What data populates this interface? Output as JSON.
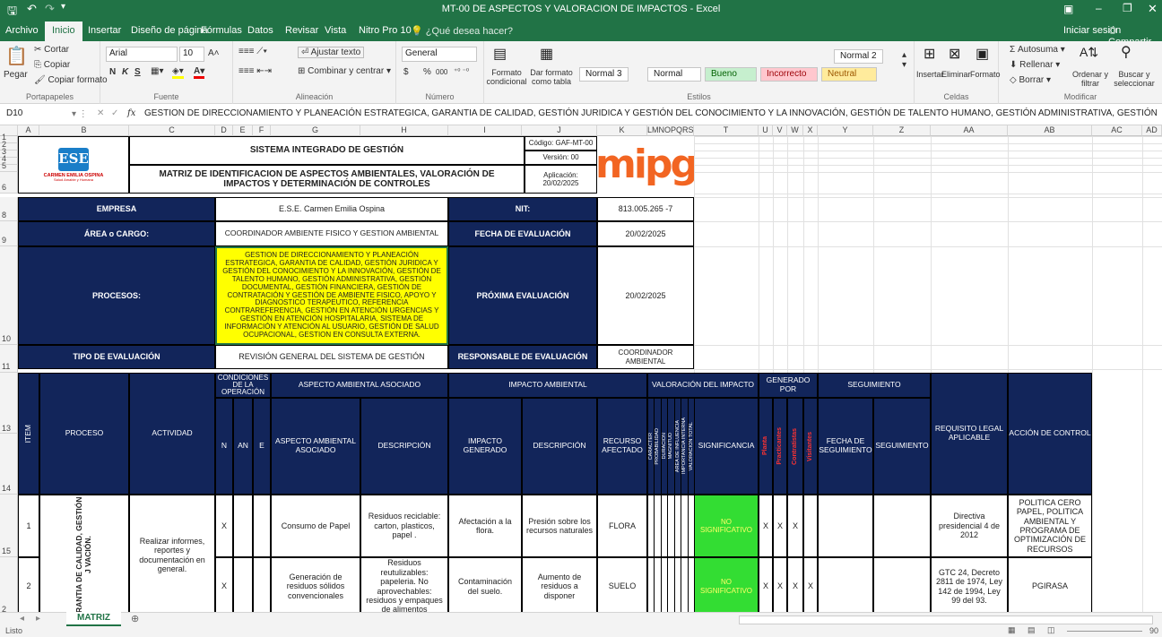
{
  "window": {
    "title": "MT-00 DE ASPECTOS Y VALORACION DE IMPACTOS - Excel",
    "signin": "Iniciar sesión",
    "share": "Compartir"
  },
  "ribbon_tabs": [
    "Archivo",
    "Inicio",
    "Insertar",
    "Diseño de página",
    "Fórmulas",
    "Datos",
    "Revisar",
    "Vista",
    "Nitro Pro 10",
    "¿Qué desea hacer?"
  ],
  "clipboard": {
    "cut": "Cortar",
    "copy": "Copiar",
    "paste": "Pegar",
    "format_painter": "Copiar formato",
    "label": "Portapapeles"
  },
  "font": {
    "name": "Arial",
    "size": "10",
    "bold": "N",
    "italic": "K",
    "underline": "S",
    "label": "Fuente"
  },
  "alignment": {
    "wrap": "Ajustar texto",
    "merge": "Combinar y centrar",
    "label": "Alineación"
  },
  "number": {
    "format": "General",
    "currency": "$",
    "percent": "%",
    "thousands": "000",
    "label": "Número"
  },
  "styles": {
    "conditional": "Formato condicional",
    "as_table": "Dar formato como tabla",
    "normal3": "Normal 3",
    "normal2": "Normal 2",
    "normal": "Normal",
    "good": "Bueno",
    "bad": "Incorrecto",
    "neutral": "Neutral",
    "label": "Estilos"
  },
  "cells_group": {
    "insert": "Insertar",
    "delete": "Eliminar",
    "format": "Formato",
    "label": "Celdas"
  },
  "editing": {
    "autosum": "Autosuma",
    "fill": "Rellenar",
    "clear": "Borrar",
    "sort": "Ordenar y filtrar",
    "find": "Buscar y seleccionar",
    "label": "Modificar"
  },
  "formula_bar": {
    "name_box": "D10",
    "fx": "fx",
    "content": "GESTION DE DIRECCIONAMIENTO Y PLANEACIÓN ESTRATEGICA, GARANTIA DE CALIDAD, GESTIÓN JURIDICA Y GESTIÓN DEL CONOCIMIENTO Y LA INNOVACIÓN, GESTIÓN DE TALENTO HUMANO, GESTIÓN ADMINISTRATIVA, GESTIÓN DOCUMENTAL, GESTIÓN FINANCIERA,"
  },
  "columns": [
    "A",
    "B",
    "C",
    "D",
    "E",
    "F",
    "G",
    "H",
    "I",
    "J",
    "K",
    "LMNOPQRS",
    "T",
    "U",
    "V",
    "W",
    "X",
    "Y",
    "Z",
    "AA",
    "AB",
    "AC",
    "AD"
  ],
  "rows": [
    "1",
    "2",
    "3",
    "4",
    "5",
    "6",
    "8",
    "9",
    "10",
    "11",
    "13",
    "14",
    "15",
    "2"
  ],
  "doc": {
    "logo_text": "ESE",
    "logo_sub": "CARMEN EMILIA OSPINA",
    "logo_tag": "Salud Amable y Humana",
    "system_title": "SISTEMA INTEGRADO DE GESTIÓN",
    "matrix_title": "MATRIZ DE IDENTIFICACION DE ASPECTOS AMBIENTALES, VALORACIÓN DE IMPACTOS Y DETERMINACIÓN DE CONTROLES",
    "code": "Código: GAF-MT-00",
    "version": "Versión: 00",
    "date": "Aplicación: 20/02/2025",
    "mipg": "mipg"
  },
  "info": {
    "empresa_label": "EMPRESA",
    "empresa_value": "E.S.E. Carmen Emilia Ospina",
    "nit_label": "NIT:",
    "nit_value": "813.005.265 -7",
    "area_label": "ÁREA o CARGO:",
    "area_value": "COORDINADOR AMBIENTE FISICO Y GESTION AMBIENTAL",
    "fecha_label": "FECHA DE EVALUACIÓN",
    "fecha_value": "20/02/2025",
    "procesos_label": "PROCESOS:",
    "procesos_value": "GESTION DE DIRECCIONAMIENTO Y PLANEACIÓN ESTRATEGICA, GARANTIA DE CALIDAD, GESTIÓN JURIDICA Y GESTIÓN DEL CONOCIMIENTO Y LA INNOVACIÓN, GESTIÓN DE TALENTO HUMANO, GESTIÓN ADMINISTRATIVA, GESTIÓN DOCUMENTAL, GESTIÓN FINANCIERA, GESTIÓN DE CONTRATACIÓN Y GESTIÓN DE AMBIENTE FISICO, APOYO Y DIAGNOSTICO TERAPEUTICO, REFERENCIA CONTRAREFERENCIA, GESTIÓN EN ATENCIÓN URGENCIAS Y GESTIÓN EN ATENCIÓN HOSPITALARIA, SISTEMA DE INFORMACIÓN Y ATENCIÓN AL USUARIO, GESTIÓN DE SALUD OCUPACIONAL, GESTION EN CONSULTA EXTERNA.",
    "proxima_label": "PRÓXIMA EVALUACIÓN",
    "proxima_value": "20/02/2025",
    "tipo_label": "TIPO DE EVALUACIÓN",
    "tipo_value": "REVISIÓN GENERAL DEL SISTEMA DE GESTIÓN",
    "responsable_label": "RESPONSABLE DE EVALUACIÓN",
    "responsable_value": "COORDINADOR AMBIENTAL"
  },
  "table_headers": {
    "item": "ITEM",
    "proceso": "PROCESO",
    "actividad": "ACTIVIDAD",
    "condiciones": "CONDICIONES DE LA OPERACIÓN",
    "n": "N",
    "an": "AN",
    "e": "E",
    "aspecto": "ASPECTO AMBIENTAL ASOCIADO",
    "aspecto_sub": "ASPECTO AMBIENTAL ASOCIADO",
    "descripcion": "DESCRIPCIÓN",
    "impacto": "IMPACTO AMBIENTAL",
    "impacto_gen": "IMPACTO GENERADO",
    "descripcion2": "DESCRIPCIÓN",
    "recurso": "RECURSO AFECTADO",
    "valoracion": "VALORACIÓN DEL IMPACTO",
    "val_cols": [
      "CARACTER",
      "PROBABILIDAD",
      "DURACIÓN",
      "MAGNITUD",
      "ÁREA DE INFLUENCIA",
      "IMPORTANCIA INTERNA",
      "VALORACIÓN TOTAL"
    ],
    "significancia": "SIGNIFICANCIA",
    "generado": "GENERADO POR",
    "gen_cols": [
      "Planta",
      "Practicantes",
      "Contratistas",
      "Visitantes"
    ],
    "seguimiento": "SEGUIMIENTO",
    "fecha_seg": "FECHA DE SEGUIMIENTO",
    "seg": "SEGUIMIENTO",
    "requisito": "REQUISITO LEGAL APLICABLE",
    "accion": "ACCIÓN DE CONTROL"
  },
  "data_rows": [
    {
      "item": "1",
      "aspecto": "Consumo de Papel",
      "descripcion": "Residuos reciclable: carton, plasticos, papel .",
      "impacto": "Afectación a la flora.",
      "descripcion2": "Presión sobre los recursos naturales",
      "recurso": "FLORA",
      "significancia": "NO SIGNIFICATIVO",
      "n": "X",
      "gen": [
        "X",
        "X",
        "X",
        ""
      ],
      "requisito": "Directiva presidencial 4 de 2012",
      "accion": "POLITICA CERO PAPEL, POLITICA AMBIENTAL Y PROGRAMA DE OPTIMIZACIÓN DE RECURSOS"
    },
    {
      "item": "2",
      "aspecto": "Generación de residuos sólidos convencionales",
      "descripcion": "Residuos reutulizables: papeleria. No aprovechables: residuos y empaques de alimentos",
      "impacto": "Contaminación del suelo.",
      "descripcion2": "Aumento de residuos a disponer",
      "recurso": "SUELO",
      "significancia": "NO SIGNIFICATIVO",
      "n": "X",
      "gen": [
        "X",
        "X",
        "X",
        "X"
      ],
      "requisito": "GTC 24, Decreto 2811 de 1974, Ley 142 de 1994, Ley 99 del 93.",
      "accion": "PGIRASA"
    }
  ],
  "proceso_vertical": "RANTIA DE CALIDAD, GESTIÓN J VACIÓN.",
  "actividad": "Realizar informes, reportes y documentación en general.",
  "sheet_tab": "MATRIZ",
  "status": {
    "ready": "Listo",
    "zoom": "90"
  },
  "colors": {
    "excel_green": "#217346",
    "navy": "#12255a",
    "highlight_yellow": "#ffff00",
    "sig_green": "#33dd33",
    "mipg_orange": "#f26522"
  }
}
